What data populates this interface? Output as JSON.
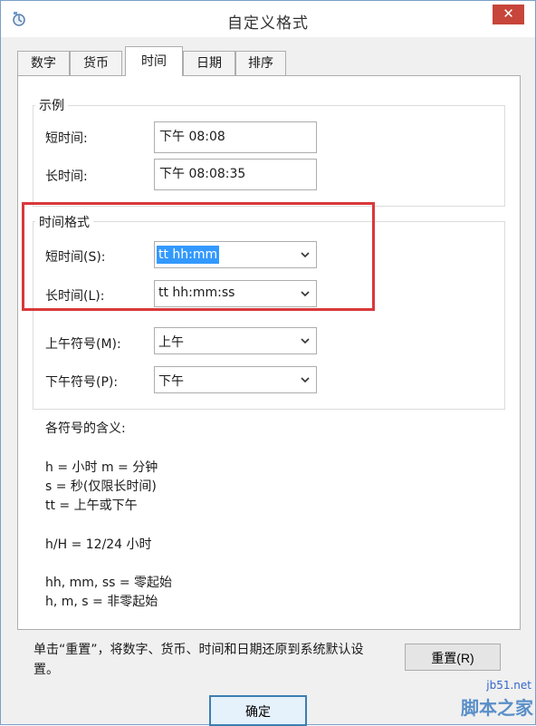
{
  "window": {
    "title": "自定义格式",
    "close_label": "✕"
  },
  "tabs": [
    {
      "label": "数字",
      "active": false
    },
    {
      "label": "货币",
      "active": false
    },
    {
      "label": "时间",
      "active": true
    },
    {
      "label": "日期",
      "active": false
    },
    {
      "label": "排序",
      "active": false
    }
  ],
  "example": {
    "title": "示例",
    "short_label": "短时间:",
    "short_value": "下午 08:08",
    "long_label": "长时间:",
    "long_value": "下午 08:08:35"
  },
  "time_format": {
    "title": "时间格式",
    "short_label": "短时间(S):",
    "short_value": "tt hh:mm",
    "long_label": "长时间(L):",
    "long_value": "tt hh:mm:ss",
    "am_label": "上午符号(M):",
    "am_value": "上午",
    "pm_label": "下午符号(P):",
    "pm_value": "下午"
  },
  "legend": {
    "title": "各符号的含义:",
    "lines": [
      "h = 小时   m = 分钟",
      "s = 秒(仅限长时间)",
      "tt = 上午或下午",
      "h/H = 12/24 小时",
      "hh, mm, ss = 零起始",
      "h, m, s = 非零起始"
    ]
  },
  "footer": {
    "note_line1": "单击“重置”，将数字、货币、时间和日期还原到系统默认设",
    "note_line2": "置。",
    "reset_label": "重置(R)",
    "ok_label": "确定"
  },
  "watermark": {
    "url": "jb51.net",
    "text": "脚本之家"
  },
  "colors": {
    "highlight": "#d9383a",
    "close": "#c7453a",
    "selection": "#3399ff"
  }
}
